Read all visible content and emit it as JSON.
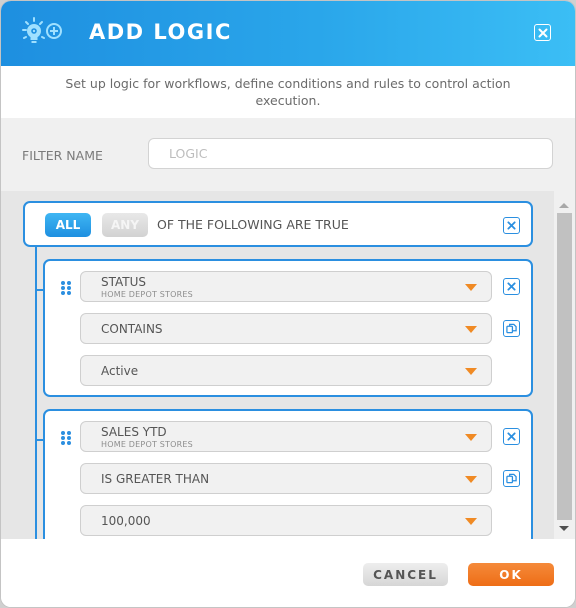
{
  "dialog": {
    "title": "ADD LOGIC",
    "subtitle": "Set up logic for workflows, define conditions and rules to control action execution.",
    "icons": {
      "header": "lightbulb-gear-plus-icon",
      "close": "close-icon"
    }
  },
  "filter": {
    "label": "FILTER NAME",
    "value": "",
    "placeholder": "LOGIC"
  },
  "group": {
    "toggle": {
      "all_label": "ALL",
      "any_label": "ANY",
      "selected": "ALL"
    },
    "text": "OF THE FOLLOWING ARE TRUE"
  },
  "conditions": [
    {
      "field": "STATUS",
      "field_source": "HOME DEPOT STORES",
      "operator": "CONTAINS",
      "value": "Active"
    },
    {
      "field": "SALES YTD",
      "field_source": "HOME DEPOT STORES",
      "operator": "IS GREATER THAN",
      "value": "100,000"
    }
  ],
  "footer": {
    "cancel_label": "CANCEL",
    "ok_label": "OK"
  },
  "colors": {
    "primary": "#2b8fe0",
    "accent": "#ee6d16",
    "caret": "#f08a24"
  }
}
